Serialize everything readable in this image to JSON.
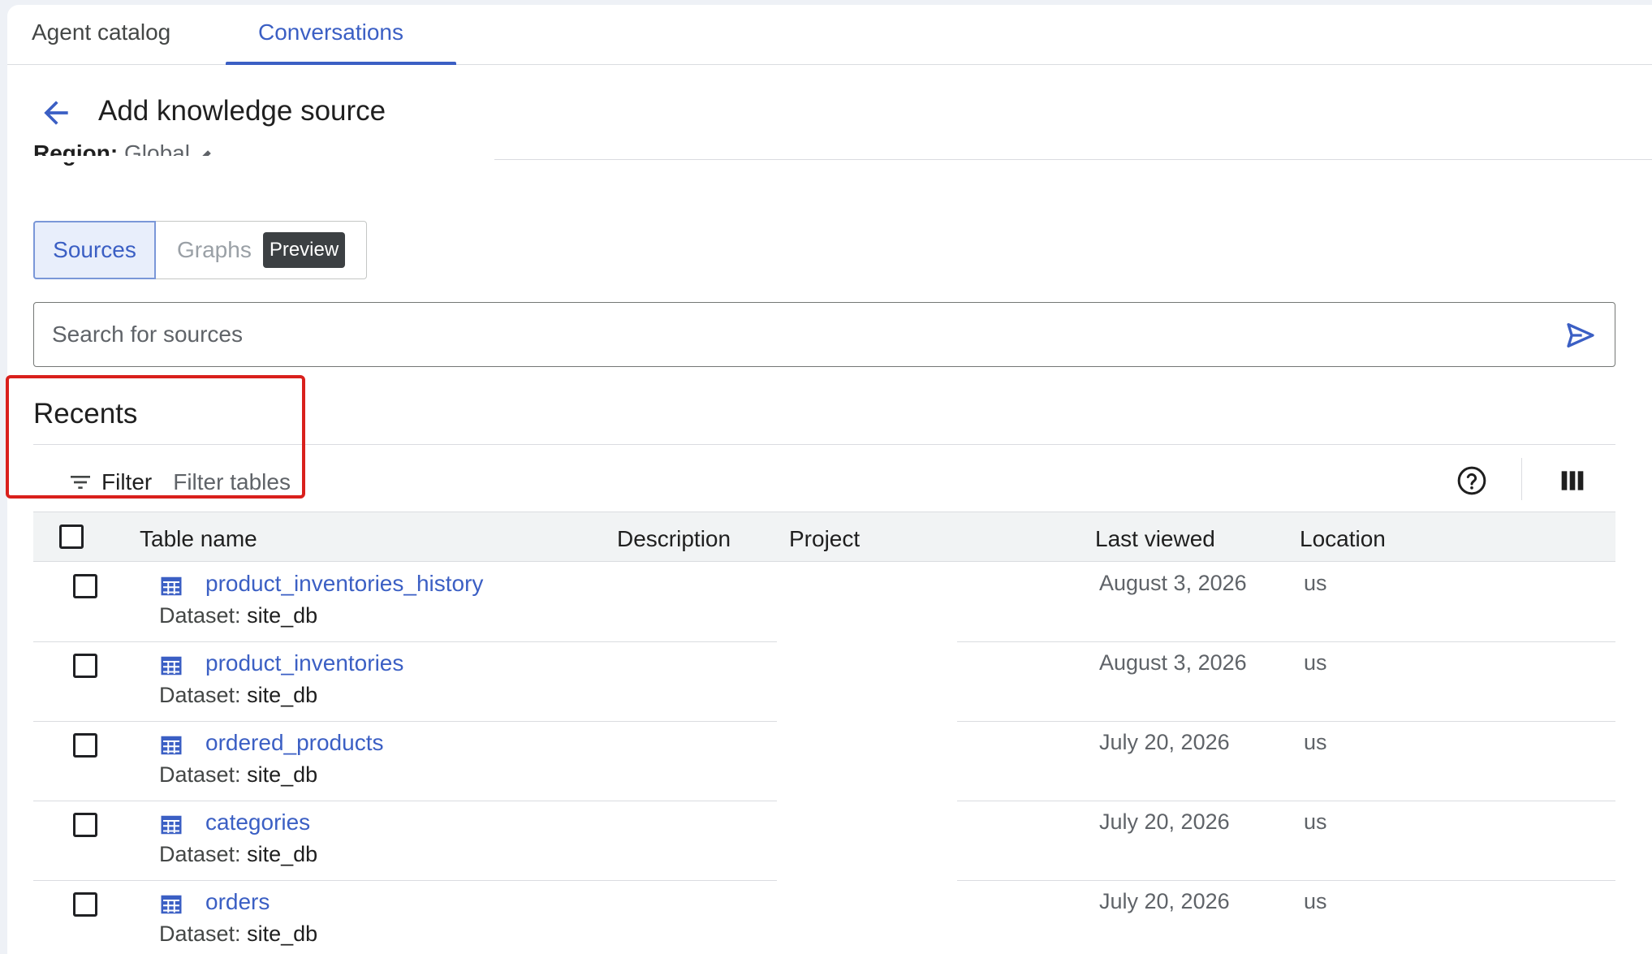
{
  "tabs": [
    {
      "label": "Agent catalog",
      "active": false
    },
    {
      "label": "Conversations",
      "active": true
    }
  ],
  "header": {
    "title": "Add knowledge source"
  },
  "region": {
    "label": "Region:",
    "value": "Global"
  },
  "segmented": {
    "sources": "Sources",
    "graphs": "Graphs",
    "badge": "Preview"
  },
  "search": {
    "placeholder": "Search for sources"
  },
  "recents": {
    "title": "Recents",
    "filter_label": "Filter",
    "filter_placeholder": "Filter tables"
  },
  "table": {
    "columns": [
      "Table name",
      "Description",
      "Project",
      "Last viewed",
      "Location"
    ],
    "dataset_key": "Dataset:",
    "rows": [
      {
        "name": "product_inventories_history",
        "dataset": "site_db",
        "last_viewed": "August 3, 2026",
        "location": "us"
      },
      {
        "name": "product_inventories",
        "dataset": "site_db",
        "last_viewed": "August 3, 2026",
        "location": "us"
      },
      {
        "name": "ordered_products",
        "dataset": "site_db",
        "last_viewed": "July 20, 2026",
        "location": "us"
      },
      {
        "name": "categories",
        "dataset": "site_db",
        "last_viewed": "July 20, 2026",
        "location": "us"
      },
      {
        "name": "orders",
        "dataset": "site_db",
        "last_viewed": "July 20, 2026",
        "location": "us"
      }
    ]
  },
  "colors": {
    "accent": "#3b5fc4",
    "highlight": "#d9201c"
  },
  "icons": [
    "back-arrow-icon",
    "edit-pencil-icon",
    "send-icon",
    "filter-icon",
    "help-icon",
    "columns-icon",
    "table-icon"
  ]
}
